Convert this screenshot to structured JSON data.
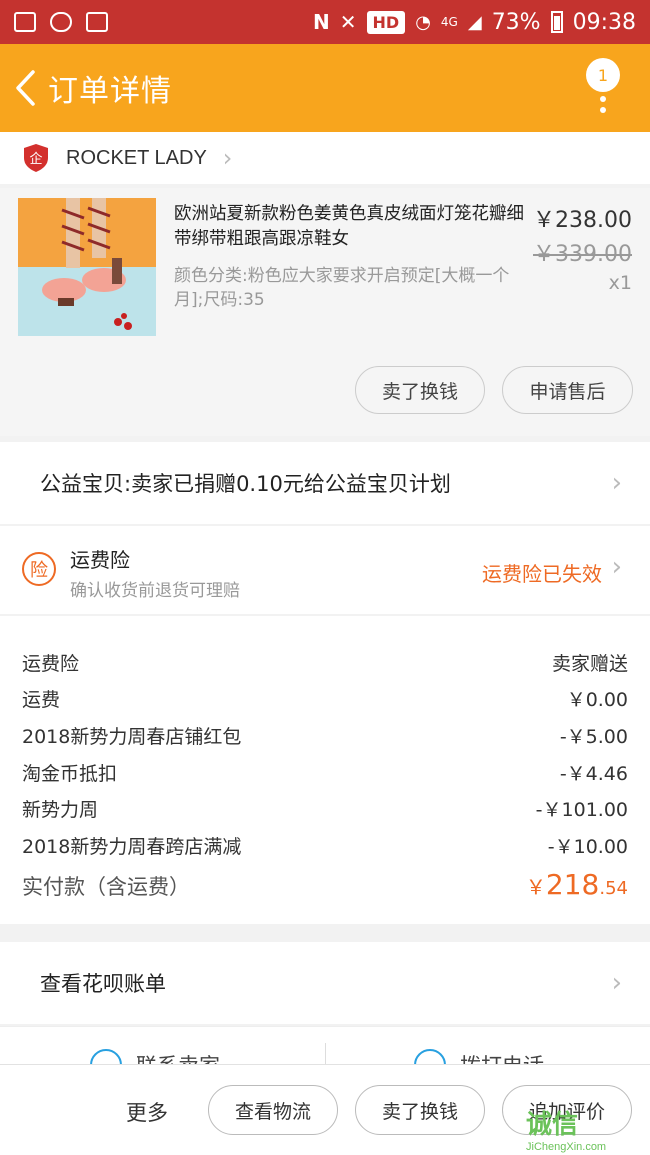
{
  "status_bar": {
    "battery": "73%",
    "time": "09:38",
    "hd": "HD",
    "network": "4G"
  },
  "nav": {
    "title": "订单详情",
    "badge": "1"
  },
  "shop": {
    "name": "ROCKET LADY"
  },
  "product": {
    "title": "欧洲站夏新款粉色姜黄色真皮绒面灯笼花瓣细带绑带粗跟高跟凉鞋女",
    "spec": "颜色分类:粉色应大家要求开启预定[大概一个月];尺码:35",
    "price": "￥238.00",
    "original_price": "￥339.00",
    "quantity": "x1",
    "buttons": [
      "卖了换钱",
      "申请售后"
    ]
  },
  "charity": {
    "text": "公益宝贝:卖家已捐赠0.10元给公益宝贝计划"
  },
  "insurance": {
    "icon_char": "险",
    "title": "运费险",
    "subtitle": "确认收货前退货可理赔",
    "status": "运费险已失效"
  },
  "fees": {
    "lines": [
      {
        "label": "运费险",
        "value": "卖家赠送"
      },
      {
        "label": "运费",
        "value": "￥0.00"
      },
      {
        "label": "2018新势力周春店铺红包",
        "value": "-￥5.00"
      },
      {
        "label": "淘金币抵扣",
        "value": "-￥4.46"
      },
      {
        "label": "新势力周",
        "value": "-￥101.00"
      },
      {
        "label": "2018新势力周春跨店满减",
        "value": "-￥10.00"
      }
    ],
    "total_label": "实付款（含运费）",
    "total_yen": "￥",
    "total_int": "218",
    "total_cents": ".54"
  },
  "huabei": {
    "text": "查看花呗账单"
  },
  "contact": {
    "left": "联系卖家",
    "right": "拨打电话"
  },
  "bottom_bar": {
    "more": "更多",
    "buttons": [
      "查看物流",
      "卖了换钱",
      "追加评价"
    ]
  },
  "watermark": {
    "main": "诚信",
    "sub": "JiChengXin.com"
  },
  "colors": {
    "accent": "#f8a51d",
    "status_bar": "#c4332f",
    "highlight": "#ee6a24"
  }
}
